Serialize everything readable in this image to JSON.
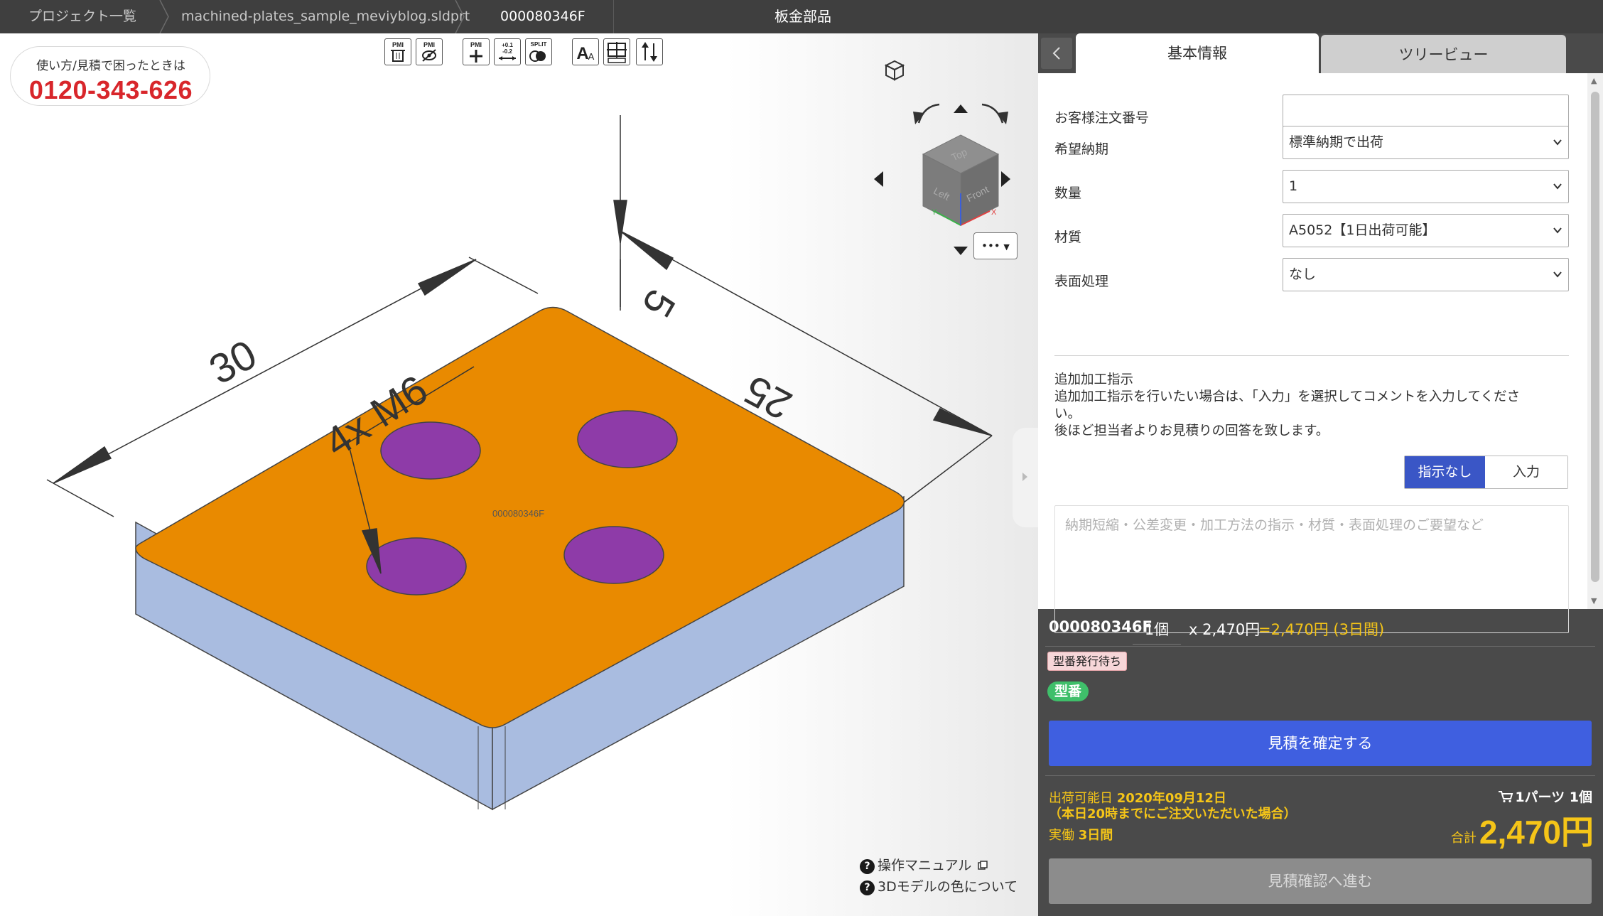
{
  "breadcrumb": {
    "items": [
      "プロジェクト一覧",
      "machined-plates_sample_meviyblog.sldprt",
      "000080346F"
    ],
    "category": "板金部品"
  },
  "viewer": {
    "help": {
      "text": "使い方/見積で困ったときは",
      "phone": "0120-343-626"
    },
    "toolbar": [
      {
        "name": "pmi-delete",
        "label": "PMI"
      },
      {
        "name": "pmi-hide",
        "label": "PMI"
      },
      {
        "name": "pmi-add",
        "label": "PMI"
      },
      {
        "name": "tolerance",
        "label": "+0.1 -0.2"
      },
      {
        "name": "split",
        "label": "SPLIT"
      },
      {
        "name": "font-size",
        "label": "A"
      },
      {
        "name": "section",
        "label": ""
      },
      {
        "name": "direction",
        "label": ""
      }
    ],
    "dimensions": {
      "length": "30",
      "width": "25",
      "thickness": "5",
      "holes": "4x M6"
    },
    "part_label": "000080346F",
    "viewcube": {
      "top": "Top",
      "left": "Left",
      "front": "Front"
    },
    "more_button": "•••",
    "links": {
      "manual": "操作マニュアル",
      "colors": "3Dモデルの色について"
    },
    "colors": {
      "top_face": "#e98a00",
      "side_face": "#a9bce0",
      "holes": "#8e3ba8"
    }
  },
  "panel": {
    "tabs": [
      "基本情報",
      "ツリービュー"
    ],
    "fields": [
      {
        "label": "お客様注文番号",
        "value": ""
      },
      {
        "label": "希望納期",
        "value": "標準納期で出荷"
      },
      {
        "label": "数量",
        "value": "1"
      },
      {
        "label": "材質",
        "value": "A5052【1日出荷可能】"
      },
      {
        "label": "表面処理",
        "value": "なし"
      }
    ],
    "extra": {
      "title": "追加加工指示",
      "line1": "追加加工指示を行いたい場合は、「入力」を選択してコメントを入力してくださ",
      "line2": "い。",
      "line3": "後ほど担当者よりお見積りの回答を致します。",
      "toggle_none": "指示なし",
      "toggle_input": "入力",
      "placeholder": "納期短縮・公差変更・加工方法の指示・材質・表面処理のご要望など"
    },
    "summary": {
      "part": "000080346F",
      "qty": "1個",
      "unit_price": "x 2,470円",
      "total": "=2,470円 (3日間)",
      "status": "型番発行待ち",
      "model_tag": "型番",
      "confirm_button": "見積を確定する",
      "ship_label": "出荷可能日",
      "ship_date": "2020年09月12日",
      "ship_note": "（本日20時までにご注文いただいた場合）",
      "work_label": "実働",
      "work_days": "3日間",
      "cart": "1パーツ 1個",
      "grand_label": "合計",
      "grand_total": "2,470円",
      "next_button": "見積確認へ進む"
    },
    "accent": "#3f5fe0",
    "price_color": "#f5c518"
  }
}
